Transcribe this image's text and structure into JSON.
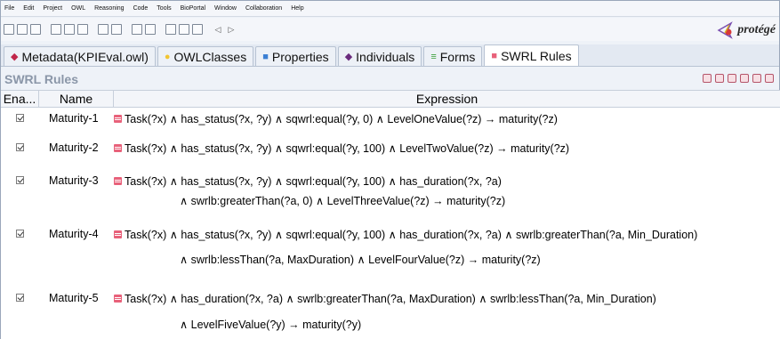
{
  "menu": [
    "File",
    "Edit",
    "Project",
    "OWL",
    "Reasoning",
    "Code",
    "Tools",
    "BioPortal",
    "Window",
    "Collaboration",
    "Help"
  ],
  "logo_text": "protégé",
  "tabs": [
    {
      "label": "Metadata(KPIEval.owl)",
      "glyph": "◆",
      "color": "#c0264a"
    },
    {
      "label": "OWLClasses",
      "glyph": "●",
      "color": "#f2c531"
    },
    {
      "label": "Properties",
      "glyph": "■",
      "color": "#3b7fd3"
    },
    {
      "label": "Individuals",
      "glyph": "◆",
      "color": "#6a2b7d"
    },
    {
      "label": "Forms",
      "glyph": "≡",
      "color": "#3ca03c"
    },
    {
      "label": "SWRL Rules",
      "glyph": "■",
      "color": "#e8617a"
    }
  ],
  "panel": {
    "title": "SWRL Rules"
  },
  "table": {
    "headers": {
      "enabled": "Ena...",
      "name": "Name",
      "expression": "Expression"
    },
    "rows": [
      {
        "name": "Maturity-1",
        "line1": "Task(?x) ∧ has_status(?x, ?y) ∧ sqwrl:equal(?y, 0) ∧ LevelOneValue(?z) → maturity(?z)",
        "line2": ""
      },
      {
        "name": "Maturity-2",
        "line1": "Task(?x) ∧ has_status(?x, ?y) ∧ sqwrl:equal(?y, 100) ∧ LevelTwoValue(?z) → maturity(?z)",
        "line2": ""
      },
      {
        "name": "Maturity-3",
        "line1": "Task(?x) ∧ has_status(?x, ?y) ∧ sqwrl:equal(?y, 100) ∧ has_duration(?x, ?a)",
        "line2": "∧ swrlb:greaterThan(?a, 0) ∧ LevelThreeValue(?z) → maturity(?z)"
      },
      {
        "name": "Maturity-4",
        "line1": "Task(?x) ∧ has_status(?x, ?y) ∧ sqwrl:equal(?y, 100) ∧ has_duration(?x, ?a) ∧ swrlb:greaterThan(?a, Min_Duration)",
        "line2": "∧ swrlb:lessThan(?a, MaxDuration) ∧ LevelFourValue(?z) → maturity(?z)"
      },
      {
        "name": "Maturity-5",
        "line1": "Task(?x) ∧ has_duration(?x, ?a) ∧ swrlb:greaterThan(?a, MaxDuration) ∧ swrlb:lessThan(?a, Min_Duration)",
        "line2": "∧ LevelFiveValue(?y) → maturity(?y)"
      }
    ]
  }
}
